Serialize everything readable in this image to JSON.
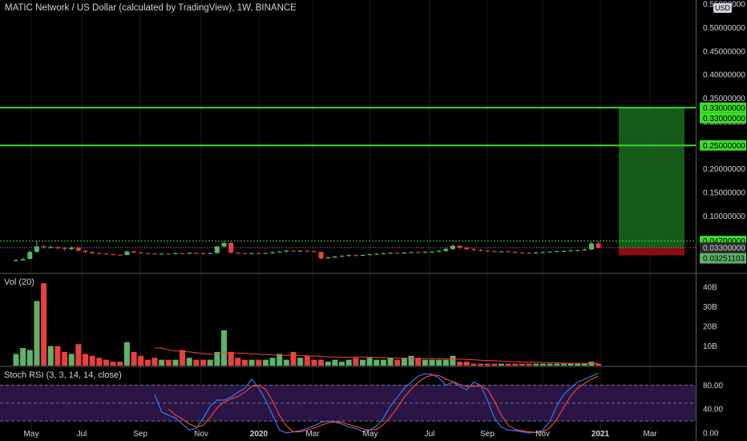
{
  "header": {
    "title": "MATIC Network / US Dollar (calculated by TradingView), 1W, BINANCE",
    "currency": "USD"
  },
  "panes": {
    "volume_label": "Vol (20)",
    "stoch_label": "Stoch RSI (3, 3, 14, 14, close)"
  },
  "colors": {
    "up": "#5fb26a",
    "down": "#e8413f",
    "horizontal_line": "#3ddc2b",
    "profit_zone": "#1b6b1f",
    "loss_zone": "#8a0d12",
    "stoch_k": "#2e7df1",
    "stoch_d": "#f44336",
    "stoch_band": "#2a1545"
  },
  "chart_data": [
    {
      "type": "candlestick",
      "title": "MATIC Network / US Dollar (calculated by TradingView), 1W, BINANCE",
      "x_tick_labels": [
        "May",
        "Jul",
        "Sep",
        "Nov",
        "2020",
        "Mar",
        "May",
        "Jul",
        "Sep",
        "Nov",
        "2021",
        "Mar"
      ],
      "y_tick_labels": [
        "0.10000000",
        "0.15000000",
        "0.20000000",
        "0.25000000",
        "0.30000000",
        "0.35000000",
        "0.40000000",
        "0.45000000",
        "0.50000000",
        "0.55000000"
      ],
      "ylim": [
        -0.02,
        0.55
      ],
      "candles": [
        [
          0.0045,
          0.0063,
          0.0095,
          0.004
        ],
        [
          0.0062,
          0.0087,
          0.012,
          0.0058
        ],
        [
          0.009,
          0.024,
          0.027,
          0.008
        ],
        [
          0.024,
          0.0355,
          0.047,
          0.022
        ],
        [
          0.0355,
          0.0335,
          0.039,
          0.03
        ],
        [
          0.0335,
          0.034,
          0.038,
          0.031
        ],
        [
          0.034,
          0.032,
          0.037,
          0.029
        ],
        [
          0.032,
          0.03,
          0.034,
          0.026
        ],
        [
          0.03,
          0.033,
          0.036,
          0.028
        ],
        [
          0.033,
          0.0265,
          0.034,
          0.024
        ],
        [
          0.0265,
          0.024,
          0.028,
          0.022
        ],
        [
          0.024,
          0.0215,
          0.025,
          0.02
        ],
        [
          0.0215,
          0.0205,
          0.023,
          0.019
        ],
        [
          0.0205,
          0.019,
          0.0215,
          0.0175
        ],
        [
          0.019,
          0.018,
          0.02,
          0.0165
        ],
        [
          0.018,
          0.0175,
          0.019,
          0.016
        ],
        [
          0.0175,
          0.025,
          0.027,
          0.0165
        ],
        [
          0.025,
          0.0225,
          0.0265,
          0.021
        ],
        [
          0.0225,
          0.0215,
          0.024,
          0.02
        ],
        [
          0.0215,
          0.0205,
          0.0225,
          0.019
        ],
        [
          0.0205,
          0.0195,
          0.0215,
          0.018
        ],
        [
          0.0195,
          0.02,
          0.0215,
          0.018
        ],
        [
          0.02,
          0.0195,
          0.021,
          0.018
        ],
        [
          0.0195,
          0.021,
          0.0225,
          0.0185
        ],
        [
          0.021,
          0.02,
          0.022,
          0.0185
        ],
        [
          0.02,
          0.022,
          0.0235,
          0.019
        ],
        [
          0.022,
          0.021,
          0.023,
          0.0195
        ],
        [
          0.021,
          0.0205,
          0.0225,
          0.019
        ],
        [
          0.0205,
          0.0215,
          0.023,
          0.0195
        ],
        [
          0.0215,
          0.0355,
          0.038,
          0.0205
        ],
        [
          0.0355,
          0.043,
          0.047,
          0.033
        ],
        [
          0.043,
          0.0225,
          0.045,
          0.02
        ],
        [
          0.0225,
          0.021,
          0.024,
          0.019
        ],
        [
          0.021,
          0.02,
          0.022,
          0.0185
        ],
        [
          0.02,
          0.0215,
          0.023,
          0.019
        ],
        [
          0.0215,
          0.0205,
          0.0225,
          0.019
        ],
        [
          0.0205,
          0.0215,
          0.023,
          0.0195
        ],
        [
          0.0215,
          0.0235,
          0.025,
          0.02
        ],
        [
          0.0235,
          0.0245,
          0.026,
          0.022
        ],
        [
          0.0245,
          0.0265,
          0.028,
          0.023
        ],
        [
          0.0265,
          0.025,
          0.028,
          0.0235
        ],
        [
          0.025,
          0.0265,
          0.028,
          0.024
        ],
        [
          0.0265,
          0.0255,
          0.028,
          0.024
        ],
        [
          0.0255,
          0.024,
          0.027,
          0.0225
        ],
        [
          0.024,
          0.01,
          0.025,
          0.008
        ],
        [
          0.01,
          0.012,
          0.014,
          0.009
        ],
        [
          0.012,
          0.014,
          0.016,
          0.011
        ],
        [
          0.014,
          0.0155,
          0.017,
          0.013
        ],
        [
          0.0155,
          0.017,
          0.0185,
          0.014
        ],
        [
          0.017,
          0.016,
          0.0185,
          0.015
        ],
        [
          0.016,
          0.0175,
          0.019,
          0.015
        ],
        [
          0.0175,
          0.019,
          0.0205,
          0.016
        ],
        [
          0.019,
          0.02,
          0.0215,
          0.0175
        ],
        [
          0.02,
          0.021,
          0.0225,
          0.0185
        ],
        [
          0.021,
          0.022,
          0.0235,
          0.0195
        ],
        [
          0.022,
          0.0215,
          0.0235,
          0.02
        ],
        [
          0.0215,
          0.0225,
          0.024,
          0.02
        ],
        [
          0.0225,
          0.0235,
          0.025,
          0.021
        ],
        [
          0.0235,
          0.023,
          0.025,
          0.0215
        ],
        [
          0.023,
          0.024,
          0.0255,
          0.0215
        ],
        [
          0.024,
          0.0245,
          0.026,
          0.022
        ],
        [
          0.0245,
          0.026,
          0.028,
          0.023
        ],
        [
          0.026,
          0.03,
          0.033,
          0.024
        ],
        [
          0.03,
          0.037,
          0.04,
          0.028
        ],
        [
          0.037,
          0.033,
          0.038,
          0.029
        ],
        [
          0.033,
          0.03,
          0.035,
          0.027
        ],
        [
          0.03,
          0.028,
          0.032,
          0.025
        ],
        [
          0.028,
          0.0265,
          0.03,
          0.024
        ],
        [
          0.0265,
          0.0255,
          0.0285,
          0.0235
        ],
        [
          0.0255,
          0.0245,
          0.027,
          0.0225
        ],
        [
          0.0245,
          0.025,
          0.0265,
          0.023
        ],
        [
          0.025,
          0.024,
          0.0265,
          0.0225
        ],
        [
          0.024,
          0.023,
          0.0255,
          0.0215
        ],
        [
          0.023,
          0.022,
          0.0245,
          0.0205
        ],
        [
          0.022,
          0.0215,
          0.0235,
          0.02
        ],
        [
          0.0215,
          0.0225,
          0.024,
          0.0205
        ],
        [
          0.0225,
          0.0235,
          0.025,
          0.021
        ],
        [
          0.0235,
          0.0245,
          0.026,
          0.022
        ],
        [
          0.0245,
          0.0255,
          0.027,
          0.023
        ],
        [
          0.0255,
          0.026,
          0.028,
          0.024
        ],
        [
          0.026,
          0.027,
          0.029,
          0.0245
        ],
        [
          0.027,
          0.0275,
          0.0295,
          0.025
        ],
        [
          0.0275,
          0.029,
          0.031,
          0.026
        ],
        [
          0.029,
          0.042,
          0.045,
          0.028
        ],
        [
          0.042,
          0.033,
          0.047,
          0.031
        ]
      ],
      "horizontal_lines": [
        0.33,
        0.25,
        0.047
      ],
      "position": {
        "entry": 0.033,
        "target": 0.33,
        "stop": 0.0165
      },
      "price_labels": [
        {
          "text": "0.33000000",
          "value": 0.33,
          "kind": "line"
        },
        {
          "text": "0.33000000",
          "value": 0.33,
          "kind": "target"
        },
        {
          "text": "0.25000000",
          "value": 0.25,
          "kind": "line"
        },
        {
          "text": "0.04700000",
          "value": 0.047,
          "kind": "line"
        },
        {
          "text": "0.03300000",
          "value": 0.033,
          "kind": "entry"
        },
        {
          "text": "0.03251103",
          "value": 0.03251103,
          "kind": "last"
        }
      ]
    },
    {
      "type": "bar",
      "title": "Vol (20)",
      "y_tick_labels": [
        "10B",
        "20B",
        "30B",
        "40B"
      ],
      "ylim": [
        0,
        45
      ],
      "values": [
        6,
        9,
        8,
        33,
        42,
        10,
        10,
        7,
        6,
        11,
        6,
        5,
        4,
        3,
        2,
        2,
        12,
        7,
        5,
        3,
        4,
        3,
        3,
        3,
        8,
        4,
        3,
        3,
        3,
        7,
        18,
        7,
        4,
        3,
        3,
        3,
        3,
        4,
        6,
        3,
        7,
        4,
        5,
        3,
        3,
        2,
        3,
        2,
        3,
        4,
        3,
        4,
        3,
        3,
        4,
        3,
        4,
        5,
        4,
        3,
        3,
        3,
        3,
        5,
        2,
        2,
        1,
        1,
        1,
        1,
        1,
        1,
        1,
        1,
        1,
        1,
        1,
        1,
        1,
        1,
        1,
        1,
        1,
        2,
        1
      ],
      "ma_values": [
        null,
        null,
        null,
        null,
        null,
        null,
        null,
        null,
        null,
        null,
        null,
        null,
        null,
        null,
        null,
        null,
        null,
        null,
        null,
        null,
        9,
        9,
        8,
        7.5,
        7.3,
        7,
        6.6,
        6.1,
        5.8,
        5.8,
        6.5,
        6.4,
        6.4,
        6.3,
        6,
        5.8,
        5.6,
        5.4,
        5.3,
        5.2,
        5.4,
        5.2,
        5,
        4.9,
        4.7,
        4.4,
        4.4,
        4.3,
        4.3,
        4.4,
        4.4,
        4.3,
        4.2,
        4.1,
        4,
        3.8,
        3.7,
        3.7,
        3.6,
        3.6,
        3.6,
        3.5,
        3.4,
        3.4,
        3.3,
        3.2,
        3,
        2.8,
        2.6,
        2.5,
        2.3,
        2.1,
        2,
        1.9,
        1.8,
        1.7,
        1.6,
        1.5,
        1.4,
        1.3,
        1.2,
        1.2,
        1.1,
        1.1,
        1.1
      ]
    },
    {
      "type": "line",
      "title": "Stoch RSI (3, 3, 14, 14, close)",
      "y_tick_labels": [
        "0.00",
        "40.00",
        "80.00"
      ],
      "ylim": [
        -8,
        110
      ],
      "band": [
        20,
        80
      ],
      "series": [
        {
          "values": [
            null,
            null,
            null,
            null,
            null,
            null,
            null,
            null,
            null,
            null,
            null,
            null,
            null,
            null,
            null,
            null,
            null,
            null,
            null,
            null,
            65,
            35,
            30,
            25,
            15,
            5,
            8,
            25,
            45,
            55,
            55,
            60,
            68,
            75,
            90,
            75,
            55,
            30,
            5,
            0,
            2,
            4,
            8,
            12,
            18,
            20,
            18,
            15,
            10,
            8,
            2,
            5,
            12,
            25,
            45,
            60,
            75,
            85,
            95,
            99,
            98,
            92,
            80,
            85,
            78,
            72,
            85,
            80,
            55,
            25,
            10,
            5,
            4,
            2,
            0,
            1,
            5,
            20,
            45,
            65,
            75,
            85,
            90,
            95,
            100
          ]
        },
        {
          "values": [
            null,
            null,
            null,
            null,
            null,
            null,
            null,
            null,
            null,
            null,
            null,
            null,
            null,
            null,
            null,
            null,
            null,
            null,
            null,
            null,
            null,
            null,
            40,
            30,
            23,
            15,
            10,
            13,
            26,
            42,
            52,
            57,
            61,
            68,
            78,
            80,
            73,
            53,
            30,
            12,
            2,
            2,
            5,
            8,
            13,
            17,
            19,
            18,
            14,
            11,
            7,
            5,
            6,
            14,
            27,
            43,
            60,
            73,
            85,
            93,
            97,
            96,
            90,
            86,
            81,
            78,
            78,
            79,
            73,
            53,
            30,
            13,
            6,
            4,
            2,
            1,
            2,
            9,
            23,
            43,
            62,
            75,
            83,
            90,
            95
          ]
        }
      ]
    }
  ]
}
